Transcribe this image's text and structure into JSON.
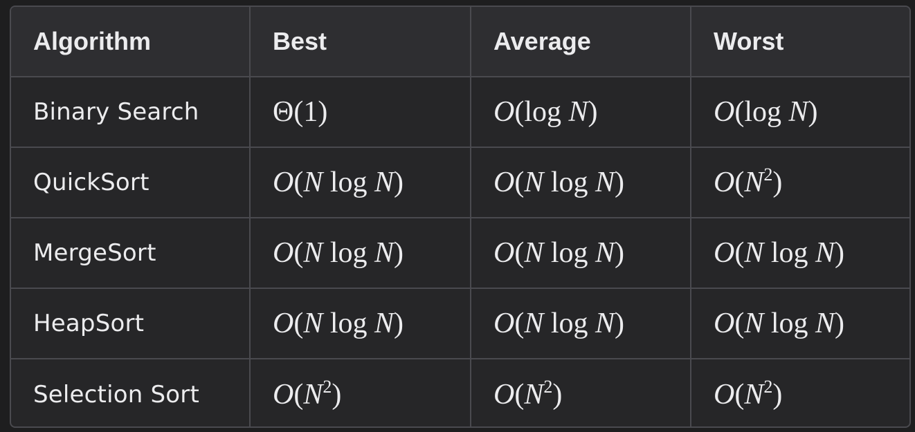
{
  "table": {
    "headers": [
      "Algorithm",
      "Best",
      "Average",
      "Worst"
    ],
    "rows": [
      {
        "algorithm": "Binary Search",
        "best": "Θ(1)",
        "average": "O(log N)",
        "worst": "O(log N)"
      },
      {
        "algorithm": "QuickSort",
        "best": "O(N log N)",
        "average": "O(N log N)",
        "worst": "O(N^2)"
      },
      {
        "algorithm": "MergeSort",
        "best": "O(N log N)",
        "average": "O(N log N)",
        "worst": "O(N log N)"
      },
      {
        "algorithm": "HeapSort",
        "best": "O(N log N)",
        "average": "O(N log N)",
        "worst": "O(N log N)"
      },
      {
        "algorithm": "Selection Sort",
        "best": "O(N^2)",
        "average": "O(N^2)",
        "worst": "O(N^2)"
      }
    ]
  }
}
